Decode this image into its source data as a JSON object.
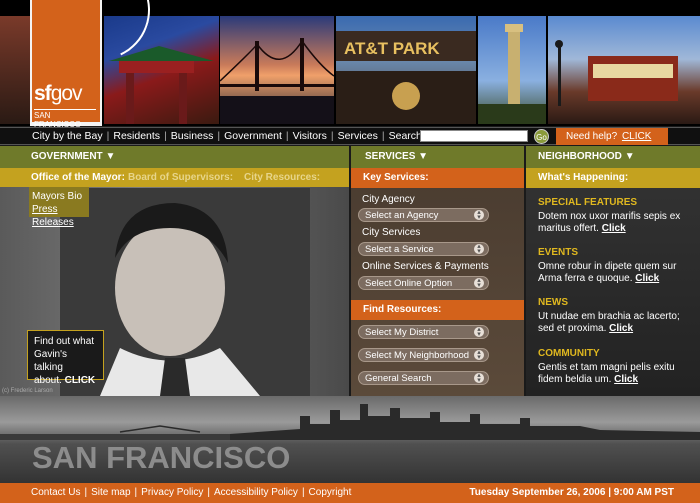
{
  "logo": {
    "sf": "sf",
    "gov": "gov",
    "city": "SAN FRANCISCO"
  },
  "topnav": {
    "links": [
      "City by the Bay",
      "Residents",
      "Business",
      "Government",
      "Visitors",
      "Services"
    ],
    "search_label": "Search SF",
    "search_value": "",
    "go_label": "Go",
    "help_text": "Need help?",
    "help_link": "CLICK HERE"
  },
  "government": {
    "header": "GOVERNMENT",
    "tabs": [
      "Office of the Mayor:",
      "Board of Supervisors:",
      "City Resources:"
    ],
    "sublinks": [
      "Mayors Bio",
      "Press Releases"
    ],
    "callout": {
      "line1": "Find out what",
      "line2": "Gavin's talking",
      "line3": "about.",
      "link": "CLICK"
    },
    "credit": "(c) Frederic Larson"
  },
  "services": {
    "header": "SERVICES",
    "key_title": "Key Services:",
    "groups": [
      {
        "label": "City Agency",
        "select": "Select an Agency"
      },
      {
        "label": "City Services",
        "select": "Select a Service"
      },
      {
        "label": "Online Services & Payments",
        "select": "Select Online Option"
      }
    ],
    "find_title": "Find Resources:",
    "find_selects": [
      "Select My District",
      "Select My Neighborhood",
      "General Search"
    ]
  },
  "neighborhood": {
    "header": "NEIGHBORHOOD",
    "title": "What's Happening:",
    "sections": [
      {
        "title": "SPECIAL FEATURES",
        "text": "Dotem nox uxor marifis sepis ex maritus offert.",
        "link": "Click"
      },
      {
        "title": "EVENTS",
        "text": "Omne robur in dipete quem sur Arma ferra e quoque.",
        "link": "Click"
      },
      {
        "title": "NEWS",
        "text": "Ut nudae em brachia ac lacerto; sed et proxima.",
        "link": "Click"
      },
      {
        "title": "COMMUNITY",
        "text": "Gentis et tam magni pelis exitu fidem beldia um.",
        "link": "Click"
      }
    ]
  },
  "skyline": {
    "title": "SAN FRANCISCO"
  },
  "footer": {
    "links": [
      "Contact Us",
      "Site map",
      "Privacy Policy",
      "Accessibility Policy",
      "Copyright"
    ],
    "date": "Tuesday September 26, 2006",
    "time": "9:00 AM PST"
  },
  "colors": {
    "orange": "#d3621b",
    "olive": "#6f7a2a",
    "gold": "#c4a21f"
  }
}
